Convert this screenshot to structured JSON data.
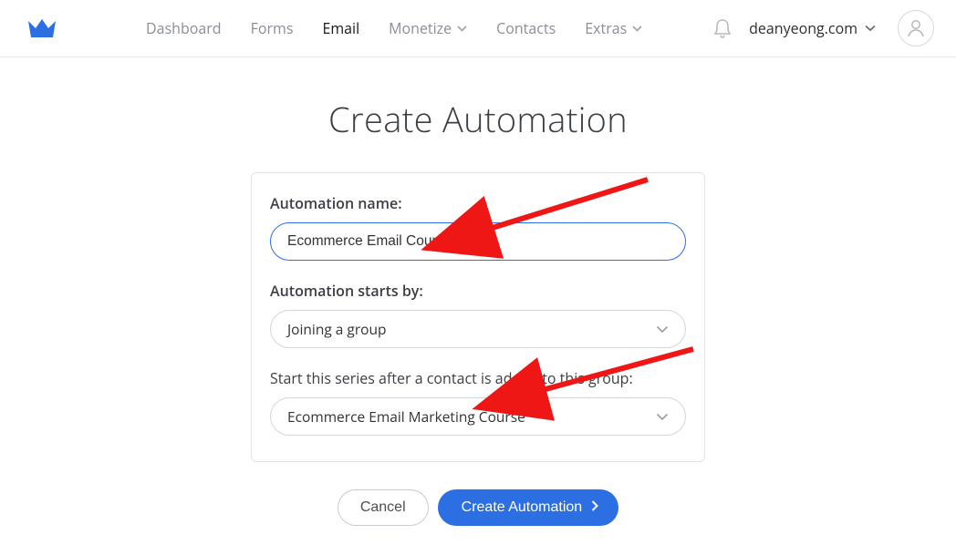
{
  "nav": {
    "items": [
      {
        "label": "Dashboard"
      },
      {
        "label": "Forms"
      },
      {
        "label": "Email",
        "active": true
      },
      {
        "label": "Monetize",
        "chevron": true
      },
      {
        "label": "Contacts"
      },
      {
        "label": "Extras",
        "chevron": true
      }
    ],
    "account": "deanyeong.com"
  },
  "page": {
    "title": "Create Automation"
  },
  "form": {
    "name_label": "Automation name:",
    "name_value": "Ecommerce Email Course",
    "trigger_label": "Automation starts by:",
    "trigger_value": "Joining a group",
    "group_label": "Start this series after a contact is added to this group:",
    "group_value": "Ecommerce Email Marketing Course"
  },
  "actions": {
    "cancel": "Cancel",
    "create": "Create Automation"
  },
  "colors": {
    "brand": "#2b6fe3",
    "annotation": "#ef1616"
  }
}
